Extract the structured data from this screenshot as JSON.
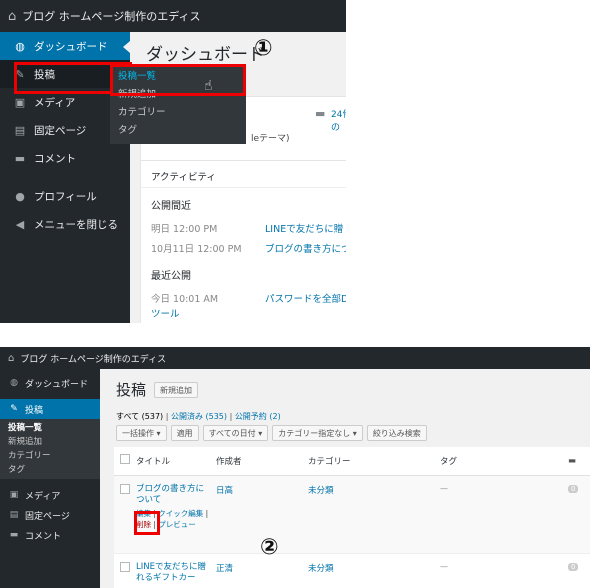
{
  "shot1": {
    "adminbar": {
      "site": "ブログ ホームページ制作のエディス"
    },
    "menu": [
      {
        "label": "ダッシュボード"
      },
      {
        "label": "投稿"
      },
      {
        "label": "メディア"
      },
      {
        "label": "固定ページ"
      },
      {
        "label": "コメント"
      },
      {
        "label": "プロフィール"
      },
      {
        "label": "メニューを閉じる"
      }
    ],
    "flyout": [
      "投稿一覧",
      "新規追加",
      "カテゴリー",
      "タグ"
    ],
    "page_title": "ダッシュボード",
    "step_number": "①",
    "glance": {
      "comments": "24件の",
      "theme_partial": "leテーマ)"
    },
    "activity": {
      "title": "アクティビティ",
      "scheduled_title": "公開間近",
      "scheduled": [
        {
          "date": "明日 12:00 PM",
          "link": "LINEで友だちに贈"
        },
        {
          "date": "10月11日 12:00 PM",
          "link": "ブログの書き方につ"
        }
      ],
      "recent_title": "最近公開",
      "recent": [
        {
          "date": "今日 10:01 AM",
          "link": "パスワードを全部D",
          "extra": "ツール"
        }
      ]
    }
  },
  "shot2": {
    "adminbar": {
      "site": "ブログ ホームページ制作のエディス"
    },
    "menu": [
      {
        "label": "ダッシュボード"
      },
      {
        "label": "投稿"
      },
      {
        "label": "メディア"
      },
      {
        "label": "固定ページ"
      },
      {
        "label": "コメント"
      }
    ],
    "submenu": [
      "投稿一覧",
      "新規追加",
      "カテゴリー",
      "タグ"
    ],
    "page_title": "投稿",
    "add_new": "新規追加",
    "filters": {
      "all": "すべて (537)",
      "published": "公開済み (535)",
      "scheduled": "公開予約 (2)"
    },
    "bulk_action": "一括操作",
    "apply": "適用",
    "all_dates": "すべての日付",
    "category_filter": "カテゴリー指定なし",
    "filter_button": "絞り込み検索",
    "columns": [
      "タイトル",
      "作成者",
      "カテゴリー",
      "タグ"
    ],
    "rows": [
      {
        "title": "ブログの書き方について",
        "author": "日高",
        "category": "未分類",
        "tags": "—",
        "comments": "0",
        "actions": [
          "編集",
          "クイック編集",
          "削除",
          "プレビュー"
        ]
      },
      {
        "title": "LINEで友だちに贈れるギフトカー",
        "author": "正清",
        "category": "未分類",
        "tags": "—",
        "comments": "0"
      }
    ],
    "step_number": "②"
  }
}
